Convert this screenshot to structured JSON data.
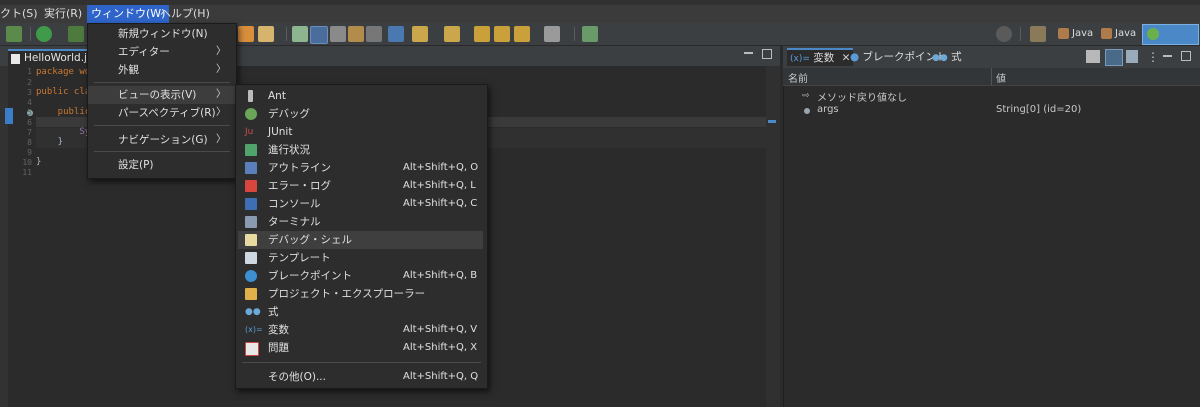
{
  "menubar": {
    "items": [
      {
        "label": "クト(S)"
      },
      {
        "label": "実行(R)"
      },
      {
        "label": "ウィンドウ(W)"
      },
      {
        "label": "ヘルプ(H)"
      }
    ]
  },
  "toolbar": {
    "perspectives": [
      {
        "label": "Java"
      },
      {
        "label": "Java"
      }
    ]
  },
  "editor": {
    "tab_label": "HelloWorld.ja",
    "line_numbers": [
      "1",
      "2",
      "3",
      "4",
      "5",
      "6",
      "7",
      "8",
      "9",
      "10",
      "11"
    ],
    "code_lines": [
      "package wo",
      "",
      "public cla",
      "",
      "    public",
      "        ",
      "        Sy",
      "    }",
      "",
      "}",
      ""
    ]
  },
  "window_menu": {
    "items": [
      {
        "label": "新規ウィンドウ(N)"
      },
      {
        "label": "エディター"
      },
      {
        "label": "外観"
      },
      {
        "label": "ビューの表示(V)"
      },
      {
        "label": "パースペクティブ(R)"
      },
      {
        "label": "ナビゲーション(G)"
      },
      {
        "label": "設定(P)"
      }
    ]
  },
  "show_view_menu": {
    "items": [
      {
        "label": "Ant",
        "shortcut": ""
      },
      {
        "label": "デバッグ",
        "shortcut": ""
      },
      {
        "label": "JUnit",
        "shortcut": ""
      },
      {
        "label": "進行状況",
        "shortcut": ""
      },
      {
        "label": "アウトライン",
        "shortcut": "Alt+Shift+Q, O"
      },
      {
        "label": "エラー・ログ",
        "shortcut": "Alt+Shift+Q, L"
      },
      {
        "label": "コンソール",
        "shortcut": "Alt+Shift+Q, C"
      },
      {
        "label": "ターミナル",
        "shortcut": ""
      },
      {
        "label": "デバッグ・シェル",
        "shortcut": ""
      },
      {
        "label": "テンプレート",
        "shortcut": ""
      },
      {
        "label": "ブレークポイント",
        "shortcut": "Alt+Shift+Q, B"
      },
      {
        "label": "プロジェクト・エクスプローラー",
        "shortcut": ""
      },
      {
        "label": "式",
        "shortcut": ""
      },
      {
        "label": "変数",
        "shortcut": "Alt+Shift+Q, V"
      },
      {
        "label": "問題",
        "shortcut": "Alt+Shift+Q, X"
      },
      {
        "label": "その他(O)...",
        "shortcut": "Alt+Shift+Q, Q"
      }
    ]
  },
  "right_panel": {
    "tabs": [
      {
        "label": "変数"
      },
      {
        "label": "ブレークポイント"
      },
      {
        "label": "式"
      }
    ],
    "columns": {
      "name": "名前",
      "value": "値"
    },
    "rows": [
      {
        "name": "メソッド戻り値なし",
        "value": ""
      },
      {
        "name": "args",
        "value": "String[0]  (id=20)"
      }
    ]
  },
  "colors": {
    "accent": "#2f65ca",
    "background": "#2b2b2b",
    "menu_bg": "#2d2d2d"
  }
}
